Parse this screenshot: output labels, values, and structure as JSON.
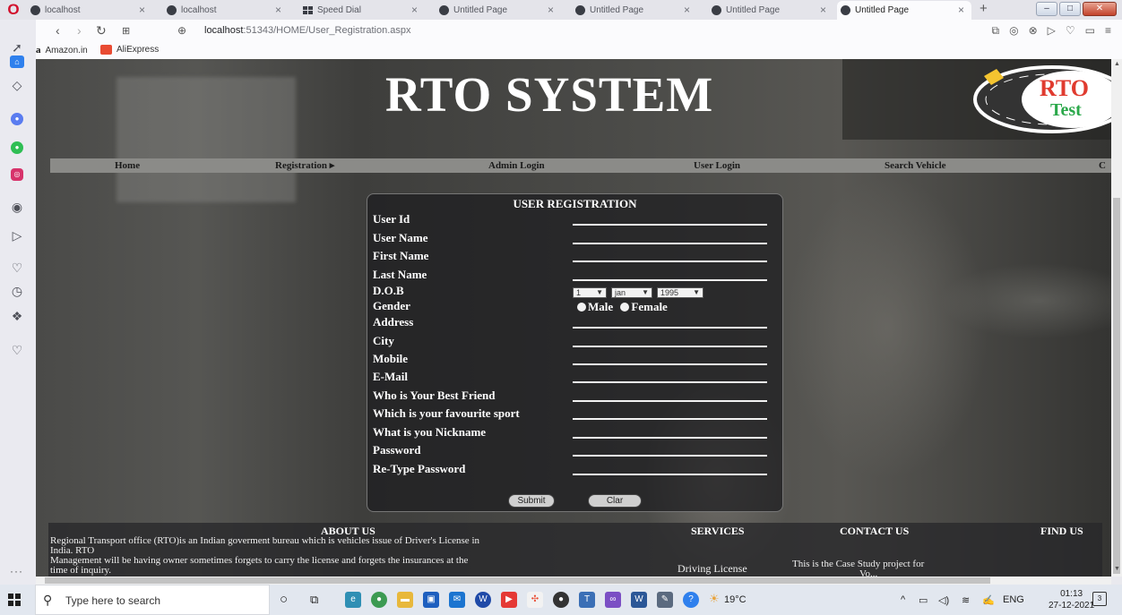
{
  "browser": {
    "tabs": [
      {
        "label": "localhost",
        "icon": "globe-icon"
      },
      {
        "label": "localhost",
        "icon": "globe-icon"
      },
      {
        "label": "Speed Dial",
        "icon": "speed-dial-icon"
      },
      {
        "label": "Untitled Page",
        "icon": "globe-icon"
      },
      {
        "label": "Untitled Page",
        "icon": "globe-icon"
      },
      {
        "label": "Untitled Page",
        "icon": "globe-icon"
      },
      {
        "label": "Untitled Page",
        "icon": "globe-icon",
        "active": true
      }
    ],
    "close_glyph": "×",
    "new_tab_glyph": "+",
    "url_host": "localhost",
    "url_path": ":51343/HOME/User_Registration.aspx",
    "bookmarks": [
      {
        "label": "Amazon.in",
        "icon": "amazon-icon"
      },
      {
        "label": "AliExpress",
        "icon": "aliexpress-icon"
      }
    ],
    "accent_color": "#d2112d"
  },
  "site": {
    "title": "RTO SYSTEM",
    "logo_text_top": "RTO",
    "logo_text_bottom": "Test",
    "menu": [
      "Home",
      "Registration ▸",
      "Admin Login",
      "User Login",
      "Search Vehicle",
      "C"
    ]
  },
  "form": {
    "heading": "USER REGISTRATION",
    "fields": [
      {
        "label": "User Id",
        "value": ""
      },
      {
        "label": "User Name",
        "value": ""
      },
      {
        "label": "First Name",
        "value": ""
      },
      {
        "label": "Last Name",
        "value": ""
      },
      {
        "label": "D.O.B"
      },
      {
        "label": "Gender"
      },
      {
        "label": "Address",
        "value": ""
      },
      {
        "label": "City",
        "value": ""
      },
      {
        "label": "Mobile",
        "value": ""
      },
      {
        "label": "E-Mail",
        "value": ""
      },
      {
        "label": "Who is Your Best Friend",
        "value": ""
      },
      {
        "label": "Which is your favourite sport",
        "value": ""
      },
      {
        "label": "What is you Nickname",
        "value": ""
      },
      {
        "label": "Password",
        "value": ""
      },
      {
        "label": "Re-Type Password",
        "value": ""
      }
    ],
    "dob": {
      "day": "1",
      "month": "jan",
      "year": "1995"
    },
    "gender_options": [
      "Male",
      "Female"
    ],
    "submit_label": "Submit",
    "clear_label": "Clar"
  },
  "footer": {
    "about_heading": "ABOUT US",
    "about_line1": "Regional Transport office (RTO)is an Indian goverment bureau which is vehicles issue of Driver's License in",
    "about_line2": "India. RTO",
    "about_line3": "Management will be having owner sometimes forgets to carry the license and forgets the insurances at the",
    "about_line4": "time of inquiry.",
    "services_heading": "SERVICES",
    "services_item": "Driving License",
    "contact_heading": "CONTACT US",
    "contact_text": "This is the Case Study project for",
    "contact_text2": "Vo...",
    "find_heading": "FIND US"
  },
  "taskbar": {
    "search_placeholder": "Type here to search",
    "temperature": "19°C",
    "language": "ENG",
    "time": "01:13",
    "date": "27-12-2021",
    "notification_count": "3"
  }
}
